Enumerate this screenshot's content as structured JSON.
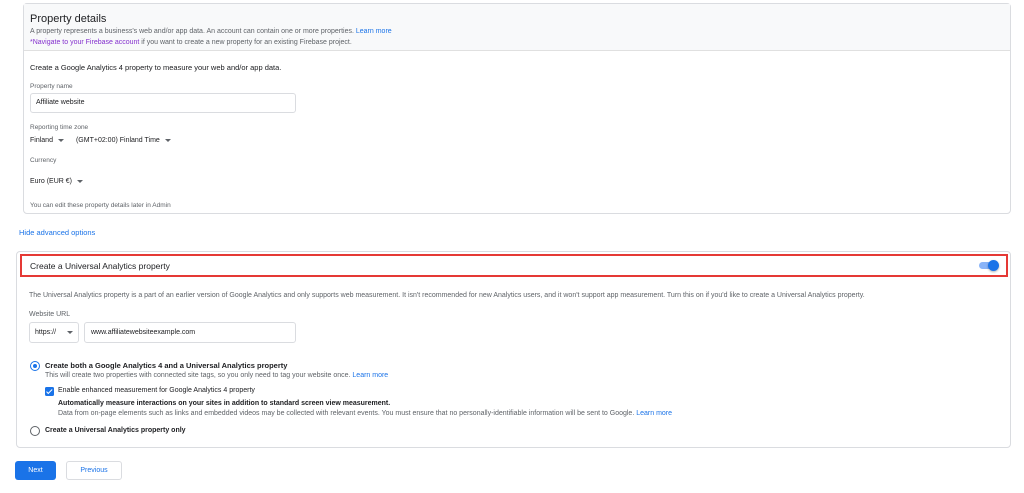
{
  "property_details": {
    "title": "Property details",
    "description": "A property represents a business's web and/or app data. An account can contain one or more properties.",
    "learn_more": "Learn more",
    "firebase_prefix": "*",
    "firebase_link": "Navigate to your Firebase account",
    "firebase_suffix": " if you want to create a new property for an existing Firebase project.",
    "intro": "Create a Google Analytics 4 property to measure your web and/or app data.",
    "property_name_label": "Property name",
    "property_name_value": "Affiliate website",
    "timezone_label": "Reporting time zone",
    "timezone_country": "Finland",
    "timezone_zone": "(GMT+02:00) Finland Time",
    "currency_label": "Currency",
    "currency_value": "Euro (EUR €)",
    "edit_note": "You can edit these property details later in Admin"
  },
  "advanced_link": "Hide advanced options",
  "universal_analytics": {
    "header_title": "Create a Universal Analytics property",
    "toggle_on": true,
    "description": "The Universal Analytics property is a part of an earlier version of Google Analytics and only supports web measurement. It isn't recommended for new Analytics users, and it won't support app measurement. Turn this on if you'd like to create a Universal Analytics property.",
    "website_url_label": "Website URL",
    "protocol": "https://",
    "website_url_value": "www.affiliatewebsiteexample.com",
    "option_both_title": "Create both a Google Analytics 4 and a Universal Analytics property",
    "option_both_sub": "This will create two properties with connected site tags, so you only need to tag your website once.",
    "option_both_learn_more": "Learn more",
    "enhanced_label": "Enable enhanced measurement for Google Analytics 4 property",
    "enhanced_title": "Automatically measure interactions on your sites in addition to standard screen view measurement.",
    "enhanced_sub": "Data from on-page elements such as links and embedded videos may be collected with relevant events. You must ensure that no personally-identifiable information will be sent to Google.",
    "enhanced_learn_more": "Learn more",
    "option_ua_only": "Create a Universal Analytics property only"
  },
  "buttons": {
    "next": "Next",
    "previous": "Previous"
  },
  "colors": {
    "accent": "#1a73e8",
    "highlight_border": "#e53935"
  }
}
